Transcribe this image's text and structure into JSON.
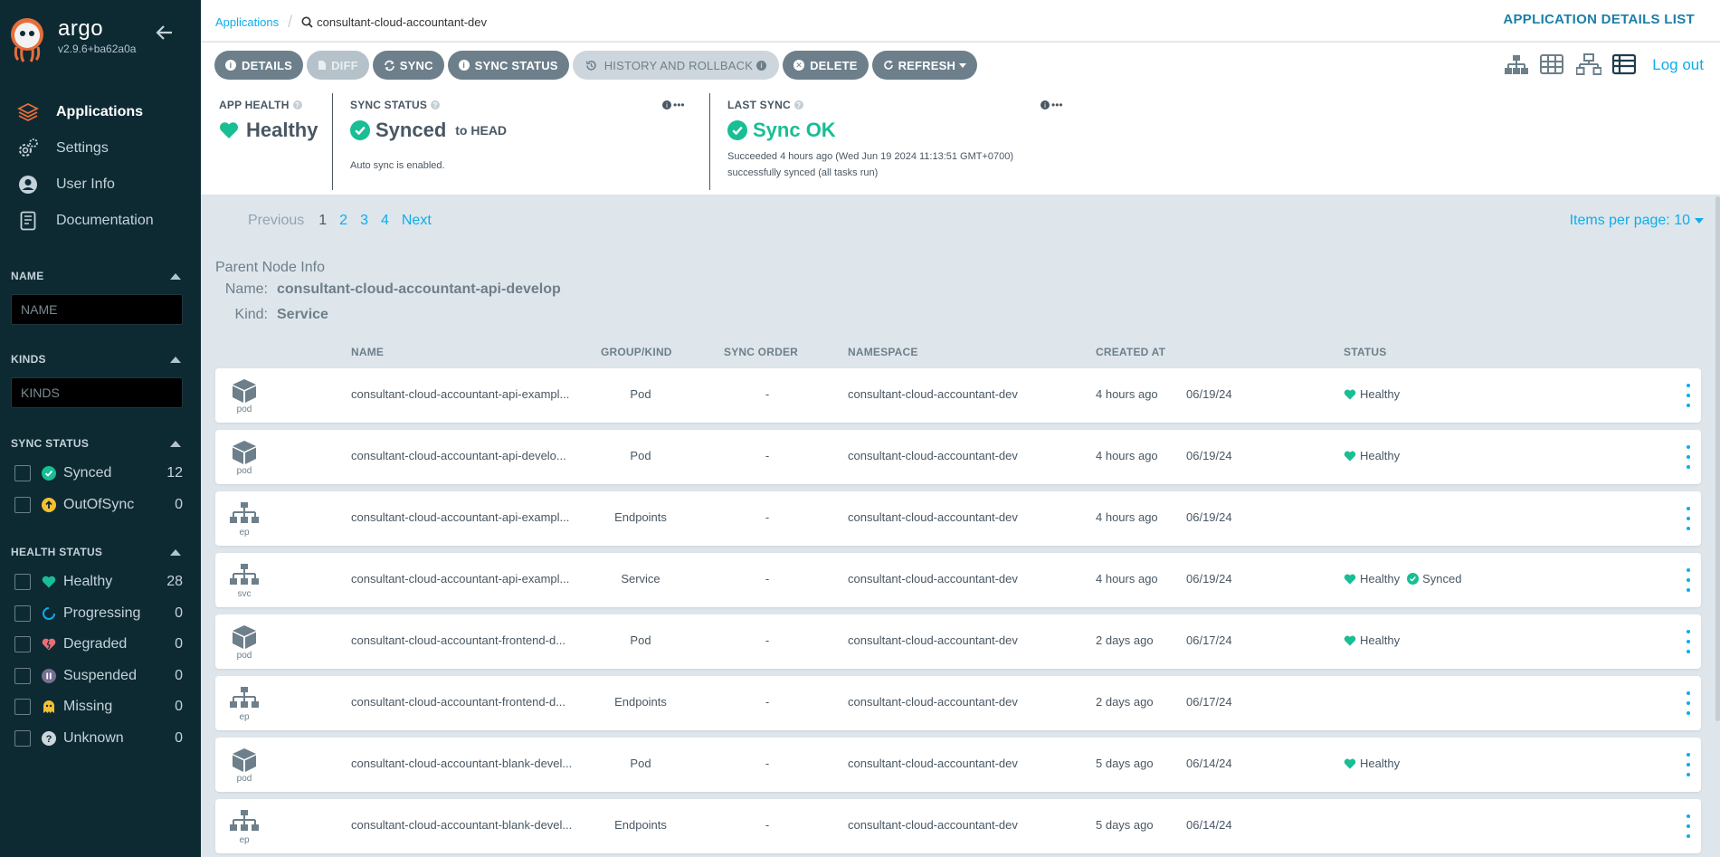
{
  "sidebar": {
    "logo_name": "argo",
    "version": "v2.9.6+ba62a0a",
    "nav": [
      {
        "label": "Applications",
        "icon": "layers-icon",
        "active": true
      },
      {
        "label": "Settings",
        "icon": "gears-icon",
        "active": false
      },
      {
        "label": "User Info",
        "icon": "user-circle-icon",
        "active": false
      },
      {
        "label": "Documentation",
        "icon": "book-icon",
        "active": false
      }
    ],
    "name_filter": {
      "title": "NAME",
      "placeholder": "NAME"
    },
    "kinds_filter": {
      "title": "KINDS",
      "placeholder": "KINDS"
    },
    "sync_status": {
      "title": "SYNC STATUS",
      "items": [
        {
          "label": "Synced",
          "count": "12",
          "color": "#18be94"
        },
        {
          "label": "OutOfSync",
          "count": "0",
          "color": "#f4c030"
        }
      ]
    },
    "health_status": {
      "title": "HEALTH STATUS",
      "items": [
        {
          "label": "Healthy",
          "count": "28",
          "color": "#18be94"
        },
        {
          "label": "Progressing",
          "count": "0",
          "color": "#0dadea"
        },
        {
          "label": "Degraded",
          "count": "0",
          "color": "#e96d76"
        },
        {
          "label": "Suspended",
          "count": "0",
          "color": "#766f94"
        },
        {
          "label": "Missing",
          "count": "0",
          "color": "#f4c030"
        },
        {
          "label": "Unknown",
          "count": "0",
          "color": "#ccd6dd"
        }
      ]
    }
  },
  "topbar": {
    "breadcrumb_root": "Applications",
    "breadcrumb_current": "consultant-cloud-accountant-dev",
    "right_title": "APPLICATION DETAILS LIST"
  },
  "toolbar": {
    "details": "DETAILS",
    "diff": "DIFF",
    "sync": "SYNC",
    "sync_status": "SYNC STATUS",
    "history": "HISTORY AND ROLLBACK",
    "delete": "DELETE",
    "refresh": "REFRESH",
    "logout": "Log out"
  },
  "status": {
    "app_health": {
      "title": "APP HEALTH",
      "value": "Healthy"
    },
    "sync_status": {
      "title": "SYNC STATUS",
      "value": "Synced",
      "to": "to HEAD",
      "note": "Auto sync is enabled."
    },
    "last_sync": {
      "title": "LAST SYNC",
      "value": "Sync OK",
      "line1": "Succeeded 4 hours ago (Wed Jun 19 2024 11:13:51 GMT+0700)",
      "line2": "successfully synced (all tasks run)"
    },
    "more": "•••"
  },
  "pager": {
    "previous": "Previous",
    "pages": [
      "1",
      "2",
      "3",
      "4"
    ],
    "next": "Next",
    "items_per_page": "Items per page: 10"
  },
  "parent_node": {
    "title": "Parent Node Info",
    "name_key": "Name:",
    "name_value": "consultant-cloud-accountant-api-develop",
    "kind_key": "Kind:",
    "kind_value": "Service"
  },
  "table": {
    "headers": {
      "name": "NAME",
      "group_kind": "GROUP/KIND",
      "sync_order": "SYNC ORDER",
      "namespace": "NAMESPACE",
      "created_at": "CREATED AT",
      "status": "STATUS"
    },
    "rows": [
      {
        "kind_label": "pod",
        "icon": "cube-icon",
        "name": "consultant-cloud-accountant-api-exampl...",
        "kind": "Pod",
        "sync_order": "-",
        "namespace": "consultant-cloud-accountant-dev",
        "age": "4 hours ago",
        "date": "06/19/24",
        "health": "Healthy",
        "sync": ""
      },
      {
        "kind_label": "pod",
        "icon": "cube-icon",
        "name": "consultant-cloud-accountant-api-develo...",
        "kind": "Pod",
        "sync_order": "-",
        "namespace": "consultant-cloud-accountant-dev",
        "age": "4 hours ago",
        "date": "06/19/24",
        "health": "Healthy",
        "sync": ""
      },
      {
        "kind_label": "ep",
        "icon": "network-icon",
        "name": "consultant-cloud-accountant-api-exampl...",
        "kind": "Endpoints",
        "sync_order": "-",
        "namespace": "consultant-cloud-accountant-dev",
        "age": "4 hours ago",
        "date": "06/19/24",
        "health": "",
        "sync": ""
      },
      {
        "kind_label": "svc",
        "icon": "network-icon",
        "name": "consultant-cloud-accountant-api-exampl...",
        "kind": "Service",
        "sync_order": "-",
        "namespace": "consultant-cloud-accountant-dev",
        "age": "4 hours ago",
        "date": "06/19/24",
        "health": "Healthy",
        "sync": "Synced"
      },
      {
        "kind_label": "pod",
        "icon": "cube-icon",
        "name": "consultant-cloud-accountant-frontend-d...",
        "kind": "Pod",
        "sync_order": "-",
        "namespace": "consultant-cloud-accountant-dev",
        "age": "2 days ago",
        "date": "06/17/24",
        "health": "Healthy",
        "sync": ""
      },
      {
        "kind_label": "ep",
        "icon": "network-icon",
        "name": "consultant-cloud-accountant-frontend-d...",
        "kind": "Endpoints",
        "sync_order": "-",
        "namespace": "consultant-cloud-accountant-dev",
        "age": "2 days ago",
        "date": "06/17/24",
        "health": "",
        "sync": ""
      },
      {
        "kind_label": "pod",
        "icon": "cube-icon",
        "name": "consultant-cloud-accountant-blank-devel...",
        "kind": "Pod",
        "sync_order": "-",
        "namespace": "consultant-cloud-accountant-dev",
        "age": "5 days ago",
        "date": "06/14/24",
        "health": "Healthy",
        "sync": ""
      },
      {
        "kind_label": "ep",
        "icon": "network-icon",
        "name": "consultant-cloud-accountant-blank-devel...",
        "kind": "Endpoints",
        "sync_order": "-",
        "namespace": "consultant-cloud-accountant-dev",
        "age": "5 days ago",
        "date": "06/14/24",
        "health": "",
        "sync": ""
      }
    ]
  },
  "colors": {
    "accent": "#0dadea",
    "healthy": "#18be94",
    "sidebar_bg": "#0d2a33",
    "button": "#6d7f8b"
  }
}
